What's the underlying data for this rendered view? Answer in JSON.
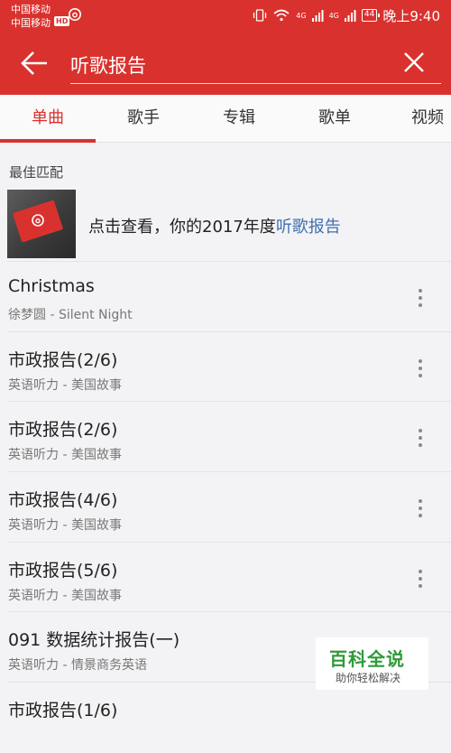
{
  "status_bar": {
    "carrier_1": "中国移动",
    "carrier_2": "中国移动",
    "hd": "HD",
    "network_1": "4G",
    "network_2": "4G",
    "battery": "44",
    "time": "晚上9:40"
  },
  "header": {
    "search_query": "听歌报告"
  },
  "tabs": [
    {
      "label": "单曲",
      "active": true
    },
    {
      "label": "歌手",
      "active": false
    },
    {
      "label": "专辑",
      "active": false
    },
    {
      "label": "歌单",
      "active": false
    },
    {
      "label": "视频",
      "active": false
    }
  ],
  "best_match": {
    "section_title": "最佳匹配",
    "text_prefix": "点击查看，你的2017年度",
    "text_highlight": "听歌报告"
  },
  "songs": [
    {
      "title": "Christmas",
      "subtitle": "徐梦圆 - Silent Night"
    },
    {
      "title": "市政报告(2/6)",
      "subtitle": "英语听力 - 美国故事"
    },
    {
      "title": "市政报告(2/6)",
      "subtitle": "英语听力 - 美国故事"
    },
    {
      "title": "市政报告(4/6)",
      "subtitle": "英语听力 - 美国故事"
    },
    {
      "title": "市政报告(5/6)",
      "subtitle": "英语听力 - 美国故事"
    },
    {
      "title": "091 数据统计报告(一)",
      "subtitle": "英语听力 - 情景商务英语"
    },
    {
      "title": "市政报告(1/6)",
      "subtitle": ""
    }
  ],
  "watermark": {
    "title": "百科全说",
    "subtitle": "助你轻松解决"
  },
  "colors": {
    "brand_red": "#d9322e",
    "link_blue": "#3f6fb0",
    "watermark_green": "#2f9a3a"
  }
}
